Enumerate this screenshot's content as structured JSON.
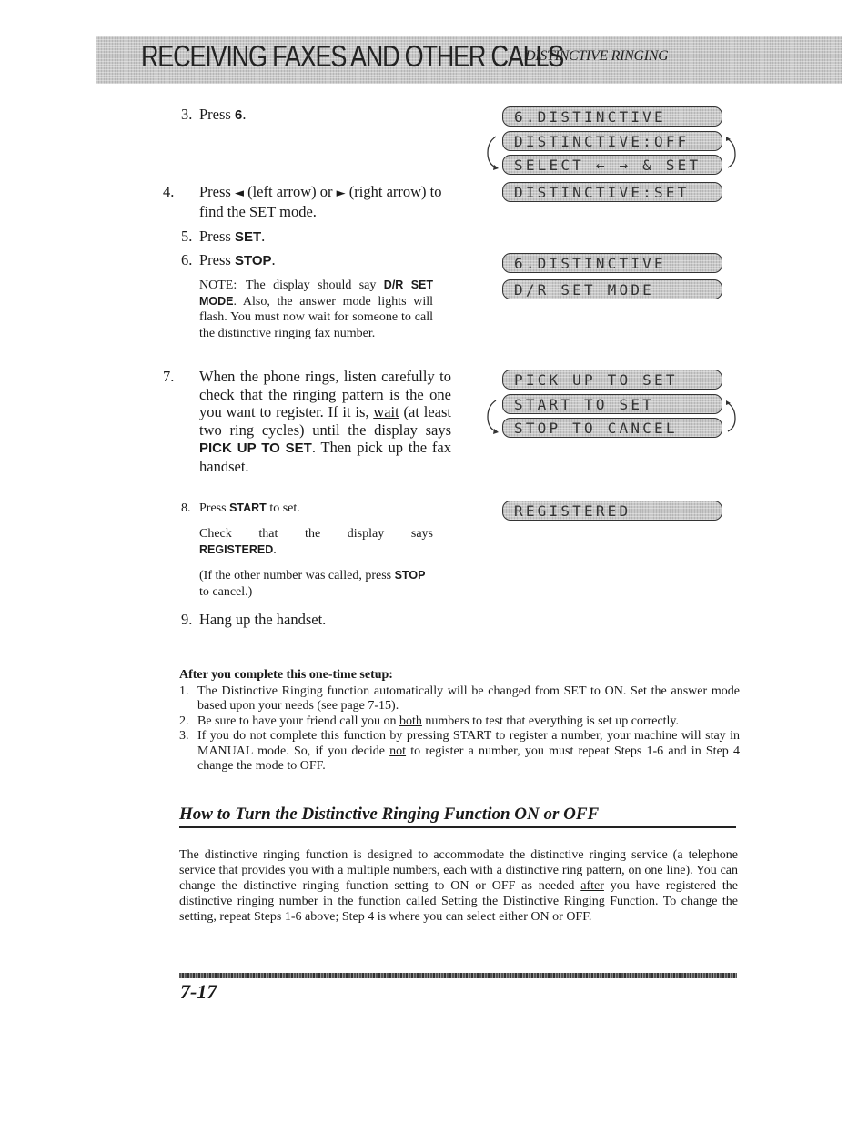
{
  "header": {
    "chapter_title": "RECEIVING FAXES AND OTHER CALLS",
    "section_title": "DISTINCTIVE RINGING"
  },
  "steps": {
    "s3": {
      "num": "3.",
      "text": "Press ",
      "key": "6",
      "end": "."
    },
    "s4": {
      "num": "4.",
      "pre": "Press ",
      "left_icon": "◄",
      "mid": " (left arrow) or ",
      "right_icon": "►",
      "post": " (right arrow) to find the SET mode."
    },
    "s5": {
      "num": "5.",
      "text": "Press ",
      "key": "SET",
      "end": "."
    },
    "s6": {
      "num": "6.",
      "text": "Press ",
      "key": "STOP",
      "end": "."
    },
    "note": {
      "label": "NOTE:",
      "pre": "The display should say ",
      "key": "D/R SET MODE",
      "post": ". Also, the answer mode lights will flash. You must now wait for someone to call the distinctive ringing fax number."
    },
    "s7": {
      "num": "7.",
      "pre": "When the phone rings, listen carefully to check that the ringing pattern is the one you want to register. If it is, ",
      "underline": "wait",
      "mid": " (at least two ring cycles) until the display says ",
      "key": "PICK UP TO SET",
      "post": ". Then pick up the fax handset."
    },
    "s8": {
      "num": "8.",
      "text": "Press ",
      "key": "START",
      "end": " to set."
    },
    "check": {
      "pre": "Check that the display says ",
      "key": "REGISTERED",
      "end": "."
    },
    "other": {
      "pre": "(If the other number was called, press ",
      "key": "STOP",
      "end": " to cancel.)"
    },
    "s9": {
      "num": "9.",
      "text": "Hang up the handset."
    }
  },
  "lcd_displays": [
    "6.DISTINCTIVE",
    "DISTINCTIVE:OFF",
    "SELECT ← → & SET",
    "DISTINCTIVE:SET",
    "6.DISTINCTIVE",
    "D/R SET MODE",
    "PICK UP TO SET",
    "START TO SET",
    "STOP TO CANCEL",
    "REGISTERED"
  ],
  "after_setup": {
    "heading": "After you complete this one-time setup:",
    "items": [
      {
        "num": "1.",
        "text": "The Distinctive Ringing function automatically will be changed from SET to ON. Set the answer mode based upon your needs (see page 7-15)."
      },
      {
        "num": "2.",
        "pre": "Be sure to have your friend call you on ",
        "underline": "both",
        "post": " numbers to test that everything is set up correctly."
      },
      {
        "num": "3.",
        "pre": "If you do not complete this function by pressing START to register a number, your machine will stay in MANUAL mode. So, if you decide ",
        "underline": "not",
        "post": " to register a number, you must repeat Steps 1-6 and in Step 4 change the mode to OFF."
      }
    ]
  },
  "section": {
    "heading": "How to Turn the Distinctive Ringing Function ON or OFF",
    "pre": "The distinctive ringing function is designed to accommodate the distinctive ringing service (a telephone service that provides you with a multiple numbers, each with a distinctive ring pattern, on one line). You can change the distinctive ringing function setting to ON or OFF as needed ",
    "underline": "after",
    "post": " you have registered the distinctive ringing number in the function called Setting the Distinctive Ringing Function. To change the setting, repeat Steps 1-6 above; Step 4 is where you can select either ON or OFF."
  },
  "footer": {
    "page_number": "7-17"
  }
}
